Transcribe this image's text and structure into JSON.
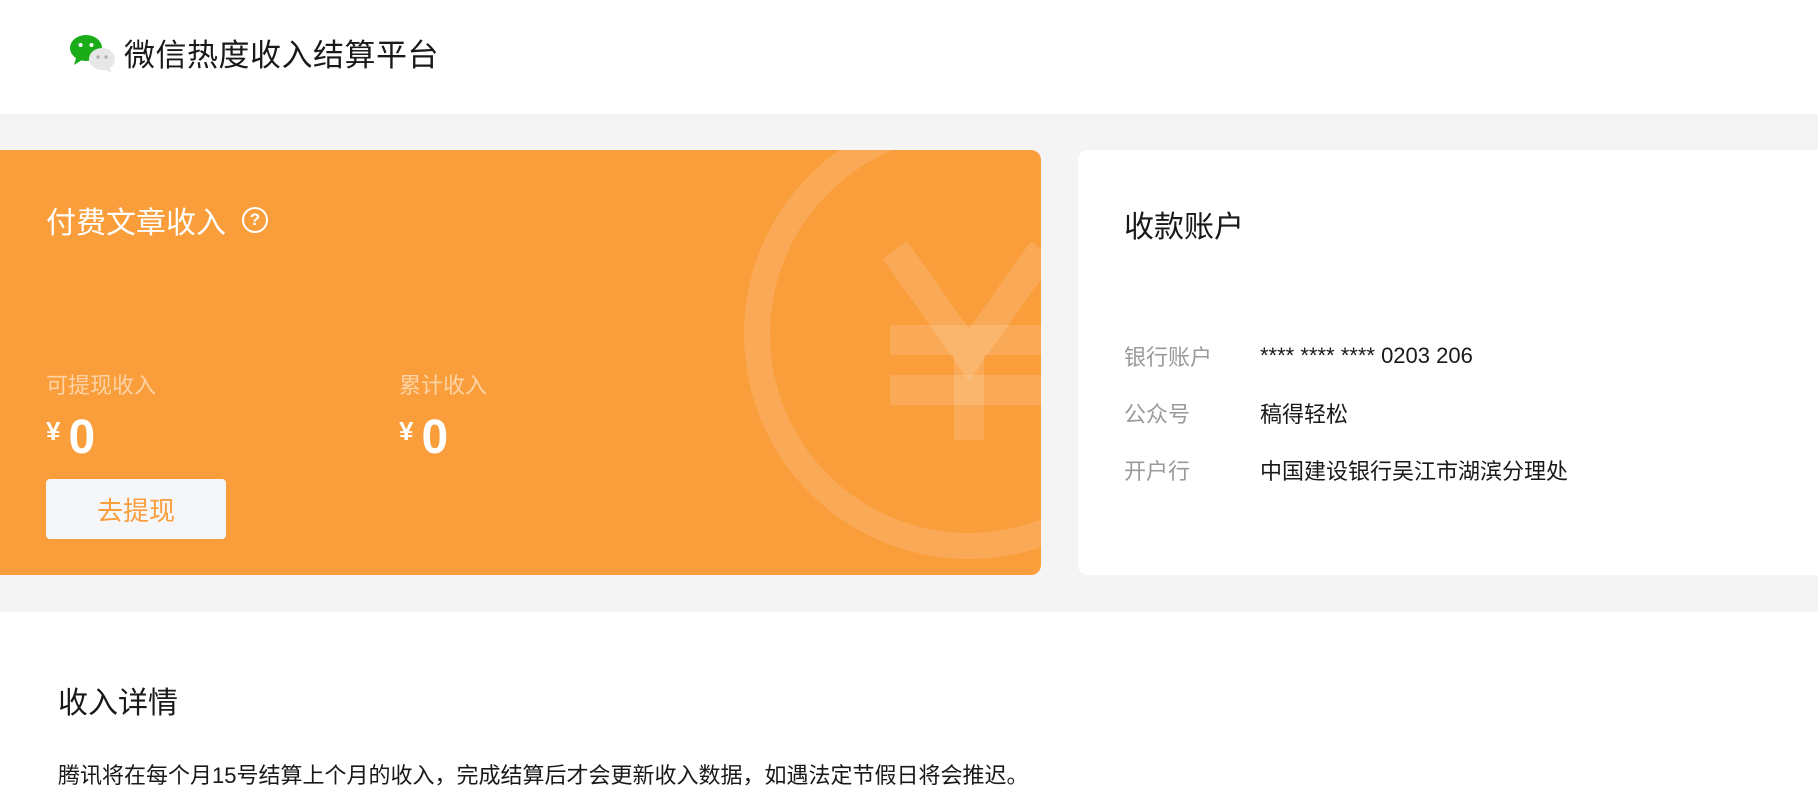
{
  "header": {
    "logo_icon": "wechat-logo-icon",
    "title": "微信热度收入结算平台"
  },
  "income_card": {
    "title": "付费文章收入",
    "help_icon": "question-circle-icon",
    "help_symbol": "?",
    "background_art": "yen-coin-icon",
    "withdrawable": {
      "label": "可提现收入",
      "currency": "¥",
      "amount": "0"
    },
    "cumulative": {
      "label": "累计收入",
      "currency": "¥",
      "amount": "0"
    },
    "withdraw_button": "去提现",
    "accent_color": "#fa9d3b"
  },
  "account_card": {
    "title": "收款账户",
    "rows": [
      {
        "key": "银行账户",
        "value": "**** **** **** 0203 206"
      },
      {
        "key": "公众号",
        "value": "稿得轻松"
      },
      {
        "key": "开户行",
        "value": "中国建设银行吴江市湖滨分理处"
      }
    ]
  },
  "detail": {
    "title": "收入详情",
    "note": "腾讯将在每个月15号结算上个月的收入，完成结算后才会更新收入数据，如遇法定节假日将会推迟。"
  }
}
